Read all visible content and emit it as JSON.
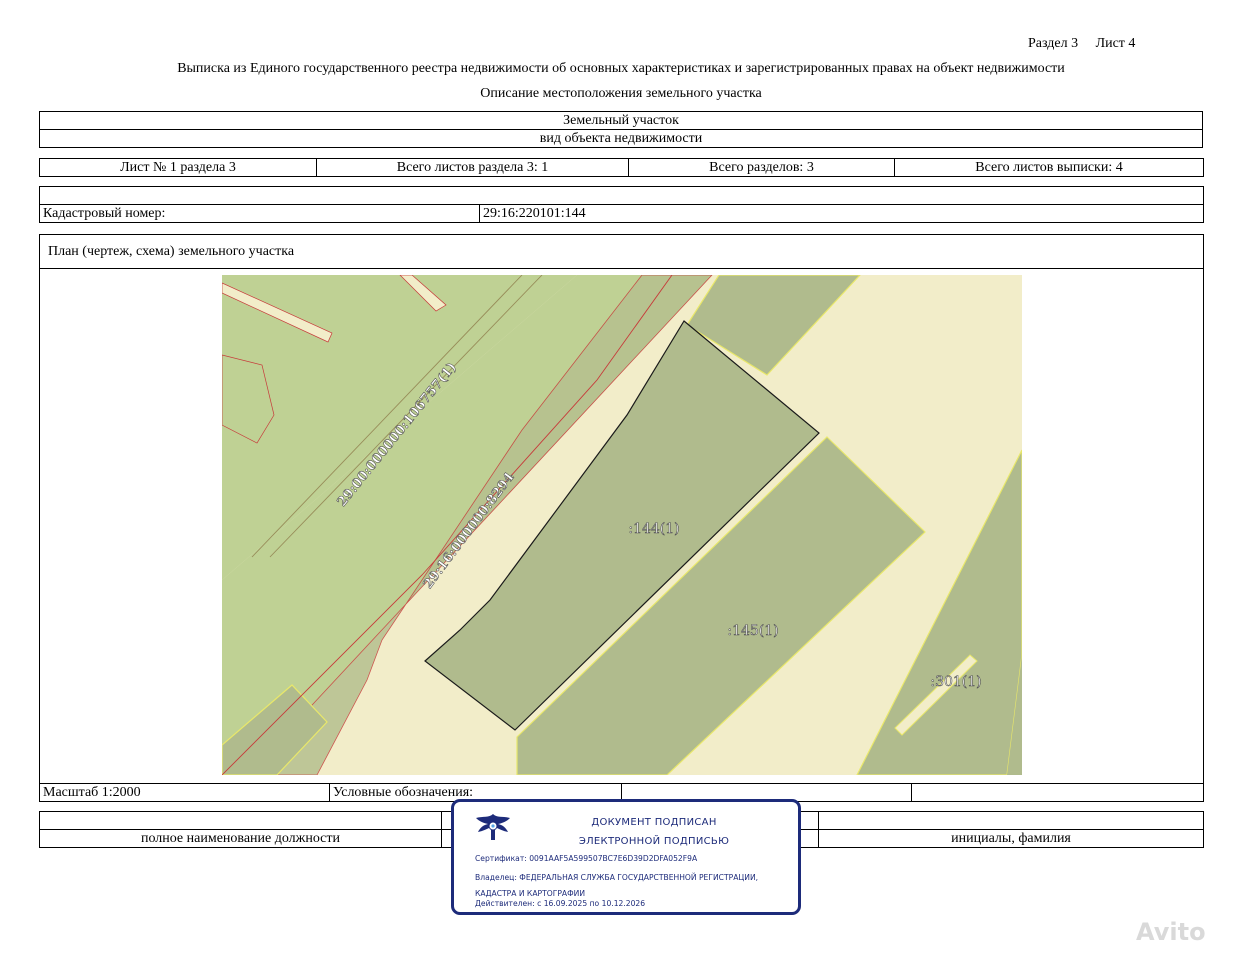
{
  "header": {
    "section": "Раздел 3",
    "sheet": "Лист 4",
    "title": "Выписка из Единого государственного реестра недвижимости об основных характеристиках и зарегистрированных правах на объект недвижимости",
    "subtitle": "Описание местоположения земельного участка"
  },
  "object": {
    "type_value": "Земельный участок",
    "type_label": "вид объекта недвижимости"
  },
  "sheet_info": {
    "sheet_no": "Лист № 1 раздела 3",
    "total_section_sheets": "Всего листов раздела 3: 1",
    "total_sections": "Всего разделов: 3",
    "total_extract_sheets": "Всего листов выписки: 4"
  },
  "cadastral": {
    "label": "Кадастровый номер:",
    "value": "29:16:220101:144"
  },
  "plan": {
    "title": "План (чертеж, схема) земельного участка",
    "labels": {
      "road_parcel": "29:00:000000:106757(1)",
      "quarter_parcel": "29:16:000000:8294",
      "parcel_144": ":144(1)",
      "parcel_145": ":145(1)",
      "parcel_301": ":301(1)"
    },
    "colors": {
      "background": "#f2edc9",
      "parcel_fill": "#b0bb8d",
      "road_fill": "#bfd194",
      "outline_yellow": "#e9e86a",
      "boundary_red": "#c73a3a"
    }
  },
  "footer_table": {
    "scale": "Масштаб 1:2000",
    "legend_label": "Условные обозначения:",
    "position_label": "полное наименование должности",
    "name_label": "инициалы, фамилия"
  },
  "stamp": {
    "line1": "ДОКУМЕНТ ПОДПИСАН",
    "line2": "ЭЛЕКТРОННОЙ ПОДПИСЬЮ",
    "certificate": "Сертификат: 0091AAF5A599507BC7E6D39D2DFA052F9A",
    "owner": "Владелец: ФЕДЕРАЛЬНАЯ СЛУЖБА ГОСУДАРСТВЕННОЙ РЕГИСТРАЦИИ, КАДАСТРА И КАРТОГРАФИИ",
    "valid": "Действителен: с 16.09.2025 по 10.12.2026",
    "color": "#1d2b7a"
  },
  "watermark": "Avito"
}
